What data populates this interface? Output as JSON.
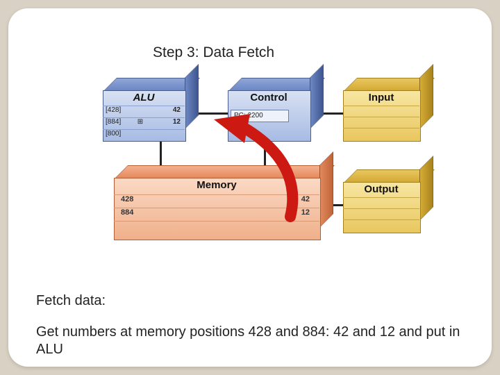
{
  "title": "Step 3: Data Fetch",
  "blocks": {
    "alu": {
      "label": "ALU",
      "rows": [
        {
          "addr": "[428]",
          "op": "",
          "val": "42"
        },
        {
          "addr": "[884]",
          "op": "⊞",
          "val": "12"
        },
        {
          "addr": "[800]",
          "op": "",
          "val": ""
        }
      ]
    },
    "control": {
      "label": "Control",
      "pc": "PC: 2200"
    },
    "input": {
      "label": "Input"
    },
    "output": {
      "label": "Output"
    },
    "memory": {
      "label": "Memory",
      "rows": [
        {
          "addr": "428",
          "val": "42"
        },
        {
          "addr": "884",
          "val": "12"
        },
        {
          "addr": "",
          "val": ""
        }
      ]
    }
  },
  "caption": {
    "heading": "Fetch data:",
    "body": "Get numbers at memory positions 428 and 884: 42 and 12 and put in ALU"
  }
}
